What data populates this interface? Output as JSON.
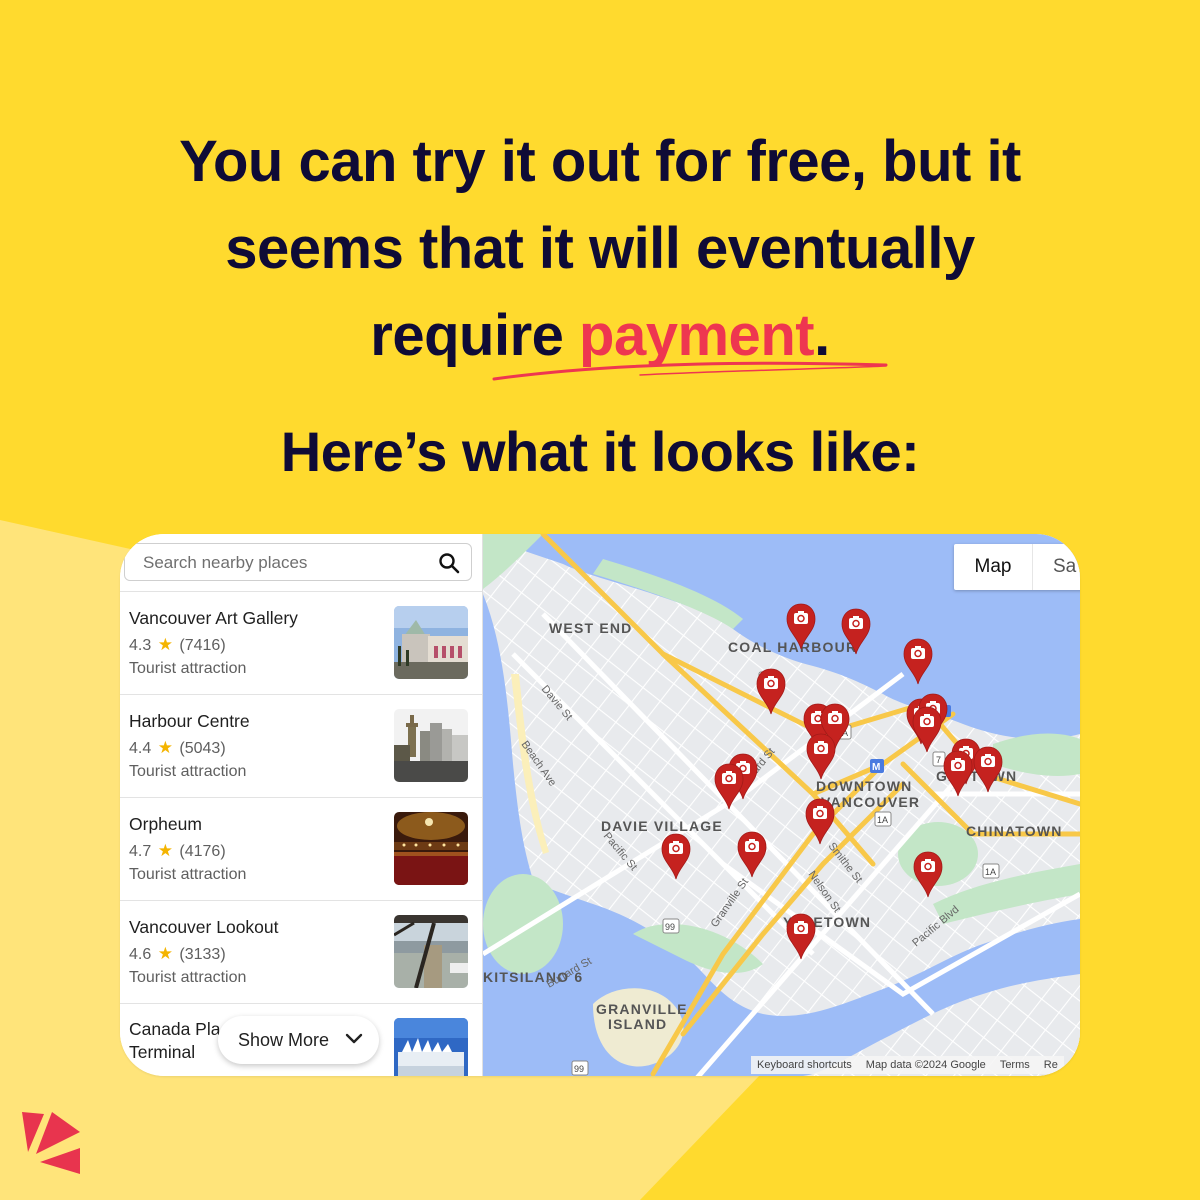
{
  "headline": {
    "line1": "You can try it out for free, but it",
    "line2": "seems that it will eventually",
    "line3_prefix": "require ",
    "line3_accent": "payment",
    "line3_suffix": "."
  },
  "subheadline": "Here’s what it looks like:",
  "colors": {
    "background": "#FFDA2E",
    "background_light": "#FFE47A",
    "text_dark": "#0F0B36",
    "accent": "#EE3650",
    "pin": "#C5221F",
    "water": "#9DBCF7",
    "park": "#C3E6C7",
    "highway": "#F8C849"
  },
  "search": {
    "placeholder": "Search nearby places",
    "icon": "search-icon"
  },
  "places": [
    {
      "name": "Vancouver Art Gallery",
      "rating": "4.3",
      "reviews": "(7416)",
      "type": "Tourist attraction"
    },
    {
      "name": "Harbour Centre",
      "rating": "4.4",
      "reviews": "(5043)",
      "type": "Tourist attraction"
    },
    {
      "name": "Orpheum",
      "rating": "4.7",
      "reviews": "(4176)",
      "type": "Tourist attraction"
    },
    {
      "name": "Vancouver Lookout",
      "rating": "4.6",
      "reviews": "(3133)",
      "type": "Tourist attraction"
    },
    {
      "name_line1": "Canada Pla",
      "name_line2": "Terminal"
    }
  ],
  "show_more": {
    "label": "Show More",
    "icon": "chevron-down-icon"
  },
  "map": {
    "type_buttons": {
      "map": "Map",
      "satellite": "Sa"
    },
    "neighborhoods": [
      "WEST END",
      "COAL HARBOUR",
      "DOWNTOWN",
      "VANCOUVER",
      "DAVIE VILLAGE",
      "GASTOWN",
      "CHINATOWN",
      "YALETOWN",
      "GRANVILLE",
      "ISLAND",
      "KITSILANO 6"
    ],
    "streets": [
      "Davie St",
      "Beach Ave",
      "Burrard St",
      "Pacific St",
      "Granville St",
      "Smithe St",
      "Nelson St",
      "Pacific Blvd",
      "Burrard St",
      "St"
    ],
    "route_shields": [
      "7A",
      "7A",
      "1A",
      "1A",
      "99",
      "99",
      "7"
    ],
    "metro": "M",
    "pin_count": 20,
    "attribution": {
      "shortcuts": "Keyboard shortcuts",
      "data": "Map data ©2024 Google",
      "terms": "Terms",
      "report": "Re"
    }
  },
  "logo": "brand-logo-icon"
}
